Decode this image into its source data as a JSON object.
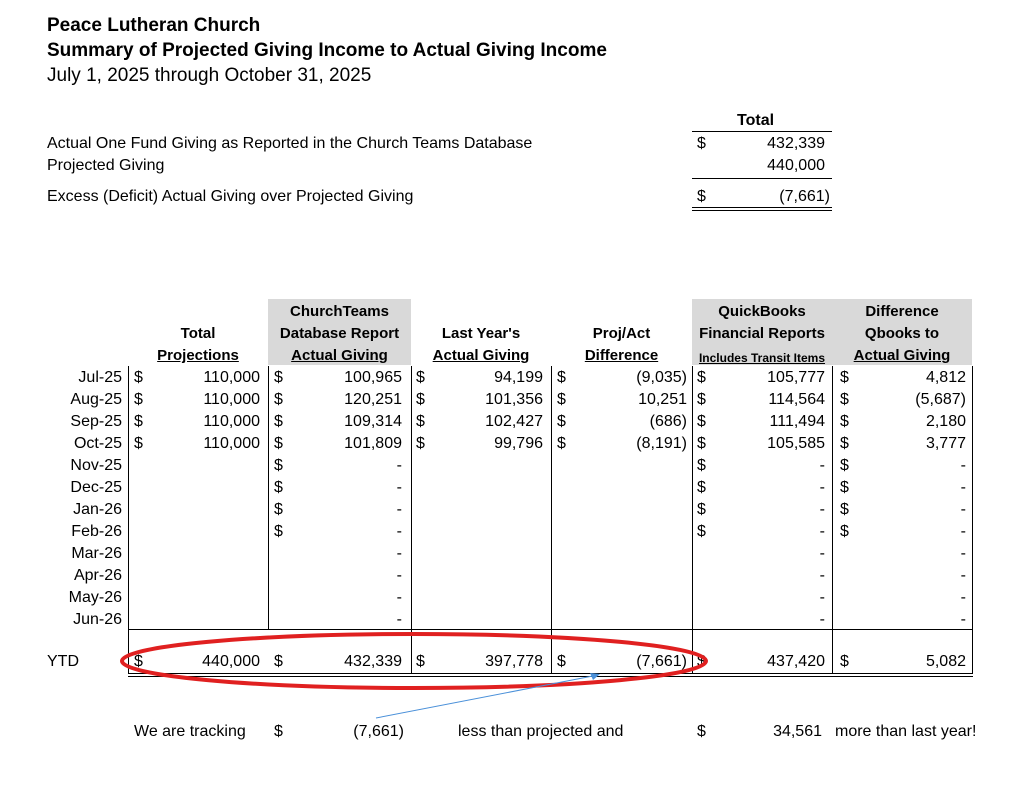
{
  "header": {
    "org": "Peace Lutheran Church",
    "report_title": "Summary of Projected Giving Income to Actual Giving Income",
    "period": "July 1, 2025 through October 31, 2025"
  },
  "summary": {
    "total_label": "Total",
    "rows": [
      {
        "label": "Actual One Fund Giving as Reported in the Church Teams Database",
        "currency": "$",
        "value": "432,339"
      },
      {
        "label": "Projected Giving",
        "currency": "",
        "value": "440,000"
      },
      {
        "label": "Excess (Deficit) Actual Giving over Projected Giving",
        "currency": "$",
        "value": "(7,661)"
      }
    ]
  },
  "table": {
    "headers": {
      "total": [
        "Total",
        "Projections"
      ],
      "churchteams": [
        "ChurchTeams",
        "Database Report",
        "Actual Giving"
      ],
      "lastyear": [
        "Last Year's",
        "Actual Giving"
      ],
      "projact": [
        "Proj/Act",
        "Difference"
      ],
      "quickbooks": [
        "QuickBooks",
        "Financial Reports",
        "Includes Transit Items"
      ],
      "difference": [
        "Difference",
        "Qbooks to",
        "Actual Giving"
      ]
    },
    "currency_symbol": "$",
    "dash": "-",
    "rows": [
      {
        "month": "Jul-25",
        "proj": "110,000",
        "ct": "100,965",
        "ly": "94,199",
        "pa": "(9,035)",
        "qb": "105,777",
        "diff": "4,812"
      },
      {
        "month": "Aug-25",
        "proj": "110,000",
        "ct": "120,251",
        "ly": "101,356",
        "pa": "10,251",
        "qb": "114,564",
        "diff": "(5,687)"
      },
      {
        "month": "Sep-25",
        "proj": "110,000",
        "ct": "109,314",
        "ly": "102,427",
        "pa": "(686)",
        "qb": "111,494",
        "diff": "2,180"
      },
      {
        "month": "Oct-25",
        "proj": "110,000",
        "ct": "101,809",
        "ly": "99,796",
        "pa": "(8,191)",
        "qb": "105,585",
        "diff": "3,777"
      },
      {
        "month": "Nov-25"
      },
      {
        "month": "Dec-25"
      },
      {
        "month": "Jan-26"
      },
      {
        "month": "Feb-26"
      },
      {
        "month": "Mar-26"
      },
      {
        "month": "Apr-26"
      },
      {
        "month": "May-26"
      },
      {
        "month": "Jun-26"
      }
    ],
    "ytd": {
      "label": "YTD",
      "proj": "440,000",
      "ct": "432,339",
      "ly": "397,778",
      "pa": "(7,661)",
      "qb": "437,420",
      "diff": "5,082"
    }
  },
  "footer": {
    "prefix": "We are tracking",
    "currency": "$",
    "amount1": "(7,661)",
    "middle": "less than projected and",
    "amount2": "34,561",
    "suffix": "more than last year!"
  },
  "annotation": {
    "ellipse_color": "#e02020",
    "arrow_color": "#4a90d9"
  }
}
